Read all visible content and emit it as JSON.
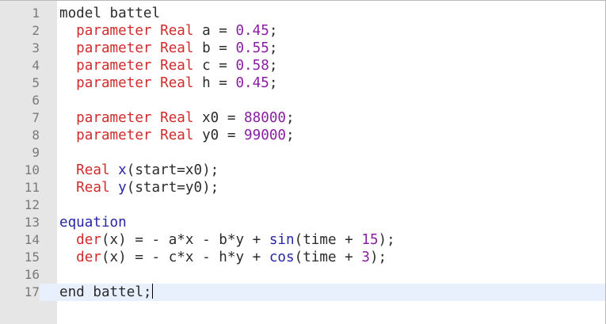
{
  "editor": {
    "lines": [
      {
        "number": "1",
        "tokens": [
          {
            "t": "model battel",
            "c": "blk"
          }
        ]
      },
      {
        "number": "2",
        "tokens": [
          {
            "t": "  parameter ",
            "c": "kw-red"
          },
          {
            "t": "Real",
            "c": "kw-red"
          },
          {
            "t": " a = ",
            "c": "blk"
          },
          {
            "t": "0.45",
            "c": "num"
          },
          {
            "t": ";",
            "c": "blk"
          }
        ]
      },
      {
        "number": "3",
        "tokens": [
          {
            "t": "  parameter ",
            "c": "kw-red"
          },
          {
            "t": "Real",
            "c": "kw-red"
          },
          {
            "t": " b = ",
            "c": "blk"
          },
          {
            "t": "0.55",
            "c": "num"
          },
          {
            "t": ";",
            "c": "blk"
          }
        ]
      },
      {
        "number": "4",
        "tokens": [
          {
            "t": "  parameter ",
            "c": "kw-red"
          },
          {
            "t": "Real",
            "c": "kw-red"
          },
          {
            "t": " c = ",
            "c": "blk"
          },
          {
            "t": "0.58",
            "c": "num"
          },
          {
            "t": ";",
            "c": "blk"
          }
        ]
      },
      {
        "number": "5",
        "tokens": [
          {
            "t": "  parameter ",
            "c": "kw-red"
          },
          {
            "t": "Real",
            "c": "kw-red"
          },
          {
            "t": " h = ",
            "c": "blk"
          },
          {
            "t": "0.45",
            "c": "num"
          },
          {
            "t": ";",
            "c": "blk"
          }
        ]
      },
      {
        "number": "6",
        "tokens": []
      },
      {
        "number": "7",
        "tokens": [
          {
            "t": "  parameter ",
            "c": "kw-red"
          },
          {
            "t": "Real",
            "c": "kw-red"
          },
          {
            "t": " x0 = ",
            "c": "blk"
          },
          {
            "t": "88000",
            "c": "num"
          },
          {
            "t": ";",
            "c": "blk"
          }
        ]
      },
      {
        "number": "8",
        "tokens": [
          {
            "t": "  parameter ",
            "c": "kw-red"
          },
          {
            "t": "Real",
            "c": "kw-red"
          },
          {
            "t": " y0 = ",
            "c": "blk"
          },
          {
            "t": "99000",
            "c": "num"
          },
          {
            "t": ";",
            "c": "blk"
          }
        ]
      },
      {
        "number": "9",
        "tokens": []
      },
      {
        "number": "10",
        "tokens": [
          {
            "t": "  Real ",
            "c": "kw-red"
          },
          {
            "t": "x",
            "c": "kw-blue"
          },
          {
            "t": "(start=x0);",
            "c": "blk"
          }
        ]
      },
      {
        "number": "11",
        "tokens": [
          {
            "t": "  Real ",
            "c": "kw-red"
          },
          {
            "t": "y",
            "c": "kw-blue"
          },
          {
            "t": "(start=y0);",
            "c": "blk"
          }
        ]
      },
      {
        "number": "12",
        "tokens": []
      },
      {
        "number": "13",
        "tokens": [
          {
            "t": "equation",
            "c": "kw-blue"
          }
        ]
      },
      {
        "number": "14",
        "tokens": [
          {
            "t": "  der",
            "c": "kw-red"
          },
          {
            "t": "(x) = - a*x - b*y + ",
            "c": "blk"
          },
          {
            "t": "sin",
            "c": "kw-blue"
          },
          {
            "t": "(time + ",
            "c": "blk"
          },
          {
            "t": "15",
            "c": "num"
          },
          {
            "t": ");",
            "c": "blk"
          }
        ]
      },
      {
        "number": "15",
        "tokens": [
          {
            "t": "  der",
            "c": "kw-red"
          },
          {
            "t": "(x) = - c*x - h*y + ",
            "c": "blk"
          },
          {
            "t": "cos",
            "c": "kw-blue"
          },
          {
            "t": "(time + ",
            "c": "blk"
          },
          {
            "t": "3",
            "c": "num"
          },
          {
            "t": ");",
            "c": "blk"
          }
        ]
      },
      {
        "number": "16",
        "tokens": []
      },
      {
        "number": "17",
        "current": true,
        "tokens": [
          {
            "t": "end battel;",
            "c": "blk"
          }
        ]
      }
    ],
    "colors": {
      "keyword_red": "#d12b2b",
      "keyword_blue": "#2727a6",
      "number_purple": "#8a1ea3",
      "gutter_bg": "#e6e6e6",
      "current_line_bg": "#e7f0fc"
    }
  }
}
